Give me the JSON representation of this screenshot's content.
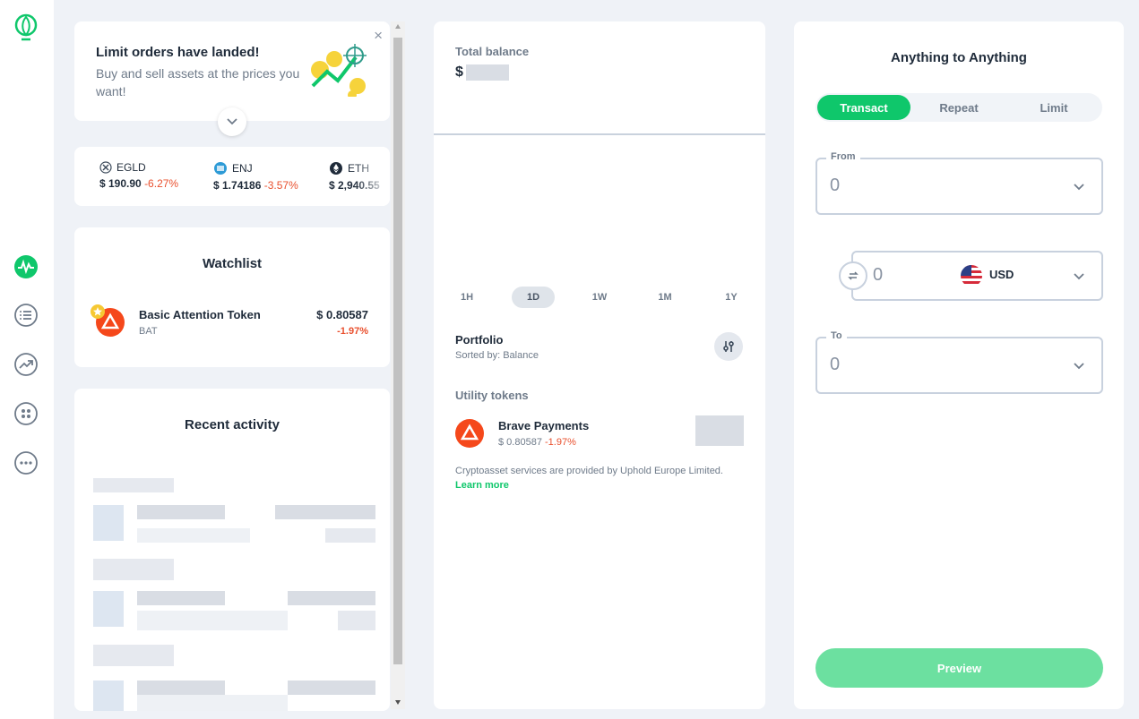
{
  "banner": {
    "title": "Limit orders have landed!",
    "text": "Buy and sell assets at the prices you want!",
    "close": "×"
  },
  "ticker": [
    {
      "symbol": "EGLD",
      "price": "$ 190.90",
      "change": "-6.27%"
    },
    {
      "symbol": "ENJ",
      "price": "$ 1.74186",
      "change": "-3.57%"
    },
    {
      "symbol": "ETH",
      "price": "$ 2,940.55",
      "change": ""
    }
  ],
  "watchlist": {
    "title": "Watchlist",
    "items": [
      {
        "name": "Basic Attention Token",
        "symbol": "BAT",
        "price": "$ 0.80587",
        "change": "-1.97%"
      }
    ]
  },
  "recent_activity": {
    "title": "Recent activity"
  },
  "balance": {
    "label": "Total balance",
    "currency": "$"
  },
  "timeframes": [
    "1H",
    "1D",
    "1W",
    "1M",
    "1Y"
  ],
  "timeframe_selected": "1D",
  "portfolio": {
    "title": "Portfolio",
    "sorted_by": "Sorted by: Balance",
    "group": "Utility tokens",
    "items": [
      {
        "name": "Brave Payments",
        "price": "$ 0.80587",
        "change": "-1.97%"
      }
    ],
    "disclaimer": "Cryptoasset services are provided by Uphold Europe Limited.",
    "learn_more": "Learn more"
  },
  "trade": {
    "title": "Anything to Anything",
    "tabs": [
      "Transact",
      "Repeat",
      "Limit"
    ],
    "active_tab": "Transact",
    "from_label": "From",
    "from_value": "0",
    "amount_value": "0",
    "currency": "USD",
    "to_label": "To",
    "to_value": "0",
    "preview": "Preview"
  },
  "colors": {
    "brand": "#0fc76b",
    "negative": "#e9502e",
    "preview_disabled": "#6ce0a0"
  },
  "icons": [
    "logo-icon",
    "activity-icon",
    "list-icon",
    "trending-icon",
    "apps-icon",
    "more-icon"
  ]
}
